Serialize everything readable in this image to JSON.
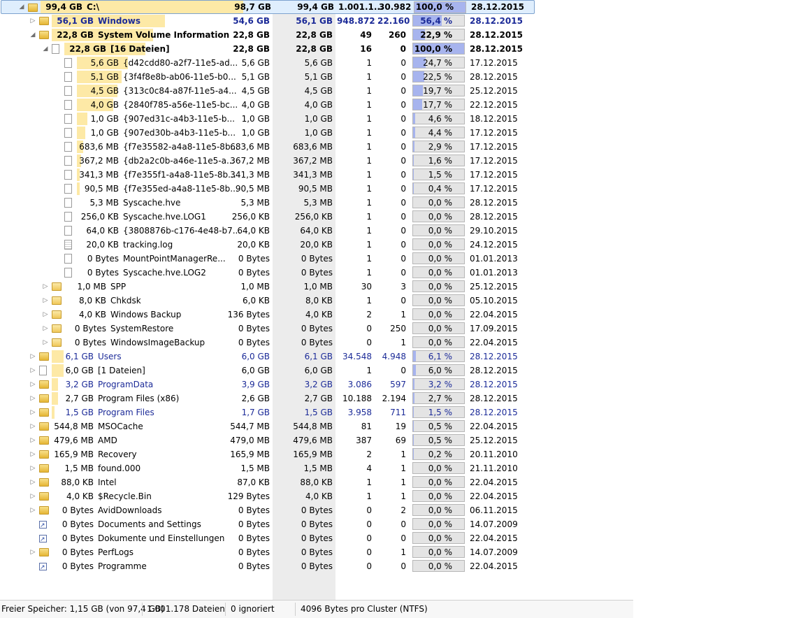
{
  "colors": {
    "size_bar": "#fde9a6",
    "percent_fill": "#a7b4ee",
    "link_text": "#1c2b98",
    "selection": "#dfeefd"
  },
  "rows": [
    {
      "depth": 0,
      "expander": "open",
      "icon": "folder",
      "style": "sel bold",
      "size": "99,4 GB",
      "name": "C:\\",
      "c1": "98,7 GB",
      "c2": "99,4 GB",
      "c3": "1.001.1...",
      "c4": "30.982",
      "pct": "100,0 %",
      "pct_value": 100,
      "date": "28.12.2015",
      "bar": 1.0
    },
    {
      "depth": 1,
      "expander": "closed",
      "icon": "folder",
      "style": "blue bold",
      "size": "56,1 GB",
      "name": "Windows",
      "c1": "54,6 GB",
      "c2": "56,1 GB",
      "c3": "948.872",
      "c4": "22.160",
      "pct": "56,4 %",
      "pct_value": 56.4,
      "date": "28.12.2015",
      "bar": 0.56
    },
    {
      "depth": 1,
      "expander": "open",
      "icon": "folder",
      "style": "bold",
      "size": "22,8 GB",
      "name": "System Volume Information",
      "c1": "22,8 GB",
      "c2": "22,8 GB",
      "c3": "49",
      "c4": "260",
      "pct": "22,9 %",
      "pct_value": 22.9,
      "date": "28.12.2015",
      "bar": 0.5
    },
    {
      "depth": 2,
      "expander": "open",
      "icon": "file",
      "style": "bold",
      "size": "22,8 GB",
      "name": "[16 Dateien]",
      "c1": "22,8 GB",
      "c2": "22,8 GB",
      "c3": "16",
      "c4": "0",
      "pct": "100,0 %",
      "pct_value": 100,
      "date": "28.12.2015",
      "bar": 0.4
    },
    {
      "depth": 3,
      "expander": "",
      "icon": "file",
      "style": "",
      "size": "5,6 GB",
      "name": "{d42cdd80-a2f7-11e5-ad...",
      "c1": "5,6 GB",
      "c2": "5,6 GB",
      "c3": "1",
      "c4": "0",
      "pct": "24,7 %",
      "pct_value": 24.7,
      "date": "17.12.2015",
      "bar": 0.25
    },
    {
      "depth": 3,
      "expander": "",
      "icon": "file",
      "style": "",
      "size": "5,1 GB",
      "name": "{3f4f8e8b-ab06-11e5-b0...",
      "c1": "5,1 GB",
      "c2": "5,1 GB",
      "c3": "1",
      "c4": "0",
      "pct": "22,5 %",
      "pct_value": 22.5,
      "date": "28.12.2015",
      "bar": 0.22
    },
    {
      "depth": 3,
      "expander": "",
      "icon": "file",
      "style": "",
      "size": "4,5 GB",
      "name": "{313c0c84-a87f-11e5-a4...",
      "c1": "4,5 GB",
      "c2": "4,5 GB",
      "c3": "1",
      "c4": "0",
      "pct": "19,7 %",
      "pct_value": 19.7,
      "date": "25.12.2015",
      "bar": 0.2
    },
    {
      "depth": 3,
      "expander": "",
      "icon": "file",
      "style": "",
      "size": "4,0 GB",
      "name": "{2840f785-a56e-11e5-bc...",
      "c1": "4,0 GB",
      "c2": "4,0 GB",
      "c3": "1",
      "c4": "0",
      "pct": "17,7 %",
      "pct_value": 17.7,
      "date": "22.12.2015",
      "bar": 0.18
    },
    {
      "depth": 3,
      "expander": "",
      "icon": "file",
      "style": "",
      "size": "1,0 GB",
      "name": "{907ed31c-a4b3-11e5-b...",
      "c1": "1,0 GB",
      "c2": "1,0 GB",
      "c3": "1",
      "c4": "0",
      "pct": "4,6 %",
      "pct_value": 4.6,
      "date": "18.12.2015",
      "bar": 0.05
    },
    {
      "depth": 3,
      "expander": "",
      "icon": "file",
      "style": "",
      "size": "1,0 GB",
      "name": "{907ed30b-a4b3-11e5-b...",
      "c1": "1,0 GB",
      "c2": "1,0 GB",
      "c3": "1",
      "c4": "0",
      "pct": "4,4 %",
      "pct_value": 4.4,
      "date": "17.12.2015",
      "bar": 0.04
    },
    {
      "depth": 3,
      "expander": "",
      "icon": "file",
      "style": "",
      "size": "683,6 MB",
      "name": "{f7e35582-a4a8-11e5-8b...",
      "c1": "683,6 MB",
      "c2": "683,6 MB",
      "c3": "1",
      "c4": "0",
      "pct": "2,9 %",
      "pct_value": 2.9,
      "date": "17.12.2015",
      "bar": 0.03
    },
    {
      "depth": 3,
      "expander": "",
      "icon": "file",
      "style": "",
      "size": "367,2 MB",
      "name": "{db2a2c0b-a46e-11e5-a...",
      "c1": "367,2 MB",
      "c2": "367,2 MB",
      "c3": "1",
      "c4": "0",
      "pct": "1,6 %",
      "pct_value": 1.6,
      "date": "17.12.2015",
      "bar": 0.02
    },
    {
      "depth": 3,
      "expander": "",
      "icon": "file",
      "style": "",
      "size": "341,3 MB",
      "name": "{f7e355f1-a4a8-11e5-8b...",
      "c1": "341,3 MB",
      "c2": "341,3 MB",
      "c3": "1",
      "c4": "0",
      "pct": "1,5 %",
      "pct_value": 1.5,
      "date": "17.12.2015",
      "bar": 0.015
    },
    {
      "depth": 3,
      "expander": "",
      "icon": "file",
      "style": "",
      "size": "90,5 MB",
      "name": "{f7e355ed-a4a8-11e5-8b...",
      "c1": "90,5 MB",
      "c2": "90,5 MB",
      "c3": "1",
      "c4": "0",
      "pct": "0,4 %",
      "pct_value": 0.4,
      "date": "17.12.2015",
      "bar": 0.005
    },
    {
      "depth": 3,
      "expander": "",
      "icon": "file",
      "style": "",
      "size": "5,3 MB",
      "name": "Syscache.hve",
      "c1": "5,3 MB",
      "c2": "5,3 MB",
      "c3": "1",
      "c4": "0",
      "pct": "0,0 %",
      "pct_value": 0,
      "date": "28.12.2015",
      "bar": 0
    },
    {
      "depth": 3,
      "expander": "",
      "icon": "file",
      "style": "",
      "size": "256,0 KB",
      "name": "Syscache.hve.LOG1",
      "c1": "256,0 KB",
      "c2": "256,0 KB",
      "c3": "1",
      "c4": "0",
      "pct": "0,0 %",
      "pct_value": 0,
      "date": "28.12.2015",
      "bar": 0
    },
    {
      "depth": 3,
      "expander": "",
      "icon": "file",
      "style": "",
      "size": "64,0 KB",
      "name": "{3808876b-c176-4e48-b7...",
      "c1": "64,0 KB",
      "c2": "64,0 KB",
      "c3": "1",
      "c4": "0",
      "pct": "0,0 %",
      "pct_value": 0,
      "date": "29.10.2015",
      "bar": 0
    },
    {
      "depth": 3,
      "expander": "",
      "icon": "log",
      "style": "",
      "size": "20,0 KB",
      "name": "tracking.log",
      "c1": "20,0 KB",
      "c2": "20,0 KB",
      "c3": "1",
      "c4": "0",
      "pct": "0,0 %",
      "pct_value": 0,
      "date": "24.12.2015",
      "bar": 0
    },
    {
      "depth": 3,
      "expander": "",
      "icon": "file",
      "style": "",
      "size": "0 Bytes",
      "name": "MountPointManagerRe...",
      "c1": "0 Bytes",
      "c2": "0 Bytes",
      "c3": "1",
      "c4": "0",
      "pct": "0,0 %",
      "pct_value": 0,
      "date": "01.01.2013",
      "bar": 0
    },
    {
      "depth": 3,
      "expander": "",
      "icon": "file",
      "style": "",
      "size": "0 Bytes",
      "name": "Syscache.hve.LOG2",
      "c1": "0 Bytes",
      "c2": "0 Bytes",
      "c3": "1",
      "c4": "0",
      "pct": "0,0 %",
      "pct_value": 0,
      "date": "01.01.2013",
      "bar": 0
    },
    {
      "depth": 2,
      "expander": "closed",
      "icon": "folder",
      "style": "",
      "size": "1,0 MB",
      "name": "SPP",
      "c1": "1,0 MB",
      "c2": "1,0 MB",
      "c3": "30",
      "c4": "3",
      "pct": "0,0 %",
      "pct_value": 0,
      "date": "25.12.2015",
      "bar": 0
    },
    {
      "depth": 2,
      "expander": "closed",
      "icon": "folder",
      "style": "",
      "size": "8,0 KB",
      "name": "Chkdsk",
      "c1": "6,0 KB",
      "c2": "8,0 KB",
      "c3": "1",
      "c4": "0",
      "pct": "0,0 %",
      "pct_value": 0,
      "date": "05.10.2015",
      "bar": 0
    },
    {
      "depth": 2,
      "expander": "closed",
      "icon": "folder",
      "style": "",
      "size": "4,0 KB",
      "name": "Windows Backup",
      "c1": "136 Bytes",
      "c2": "4,0 KB",
      "c3": "2",
      "c4": "1",
      "pct": "0,0 %",
      "pct_value": 0,
      "date": "22.04.2015",
      "bar": 0
    },
    {
      "depth": 2,
      "expander": "closed",
      "icon": "folder",
      "style": "",
      "size": "0 Bytes",
      "name": "SystemRestore",
      "c1": "0 Bytes",
      "c2": "0 Bytes",
      "c3": "0",
      "c4": "250",
      "pct": "0,0 %",
      "pct_value": 0,
      "date": "17.09.2015",
      "bar": 0
    },
    {
      "depth": 2,
      "expander": "closed",
      "icon": "folder",
      "style": "",
      "size": "0 Bytes",
      "name": "WindowsImageBackup",
      "c1": "0 Bytes",
      "c2": "0 Bytes",
      "c3": "0",
      "c4": "1",
      "pct": "0,0 %",
      "pct_value": 0,
      "date": "22.04.2015",
      "bar": 0
    },
    {
      "depth": 1,
      "expander": "closed",
      "icon": "folder",
      "style": "blue",
      "size": "6,1 GB",
      "name": "Users",
      "c1": "6,0 GB",
      "c2": "6,1 GB",
      "c3": "34.548",
      "c4": "4.948",
      "pct": "6,1 %",
      "pct_value": 6.1,
      "date": "28.12.2015",
      "bar": 0.06
    },
    {
      "depth": 1,
      "expander": "closed",
      "icon": "file",
      "style": "",
      "size": "6,0 GB",
      "name": "[1 Dateien]",
      "c1": "6,0 GB",
      "c2": "6,0 GB",
      "c3": "1",
      "c4": "0",
      "pct": "6,0 %",
      "pct_value": 6.0,
      "date": "28.12.2015",
      "bar": 0.06
    },
    {
      "depth": 1,
      "expander": "closed",
      "icon": "folder",
      "style": "blue",
      "size": "3,2 GB",
      "name": "ProgramData",
      "c1": "3,9 GB",
      "c2": "3,2 GB",
      "c3": "3.086",
      "c4": "597",
      "pct": "3,2 %",
      "pct_value": 3.2,
      "date": "28.12.2015",
      "bar": 0.03
    },
    {
      "depth": 1,
      "expander": "closed",
      "icon": "folder",
      "style": "",
      "size": "2,7 GB",
      "name": "Program Files (x86)",
      "c1": "2,6 GB",
      "c2": "2,7 GB",
      "c3": "10.188",
      "c4": "2.194",
      "pct": "2,7 %",
      "pct_value": 2.7,
      "date": "28.12.2015",
      "bar": 0.03
    },
    {
      "depth": 1,
      "expander": "closed",
      "icon": "folder",
      "style": "blue",
      "size": "1,5 GB",
      "name": "Program Files",
      "c1": "1,7 GB",
      "c2": "1,5 GB",
      "c3": "3.958",
      "c4": "711",
      "pct": "1,5 %",
      "pct_value": 1.5,
      "date": "28.12.2015",
      "bar": 0.015
    },
    {
      "depth": 1,
      "expander": "closed",
      "icon": "folder",
      "style": "",
      "size": "544,8 MB",
      "name": "MSOCache",
      "c1": "544,7 MB",
      "c2": "544,8 MB",
      "c3": "81",
      "c4": "19",
      "pct": "0,5 %",
      "pct_value": 0.5,
      "date": "22.04.2015",
      "bar": 0
    },
    {
      "depth": 1,
      "expander": "closed",
      "icon": "folder",
      "style": "",
      "size": "479,6 MB",
      "name": "AMD",
      "c1": "479,0 MB",
      "c2": "479,6 MB",
      "c3": "387",
      "c4": "69",
      "pct": "0,5 %",
      "pct_value": 0.5,
      "date": "25.12.2015",
      "bar": 0
    },
    {
      "depth": 1,
      "expander": "closed",
      "icon": "folder",
      "style": "",
      "size": "165,9 MB",
      "name": "Recovery",
      "c1": "165,9 MB",
      "c2": "165,9 MB",
      "c3": "2",
      "c4": "1",
      "pct": "0,2 %",
      "pct_value": 0.2,
      "date": "20.11.2010",
      "bar": 0
    },
    {
      "depth": 1,
      "expander": "closed",
      "icon": "folder",
      "style": "",
      "size": "1,5 MB",
      "name": "found.000",
      "c1": "1,5 MB",
      "c2": "1,5 MB",
      "c3": "4",
      "c4": "1",
      "pct": "0,0 %",
      "pct_value": 0,
      "date": "21.11.2010",
      "bar": 0
    },
    {
      "depth": 1,
      "expander": "closed",
      "icon": "folder",
      "style": "",
      "size": "88,0 KB",
      "name": "Intel",
      "c1": "87,0 KB",
      "c2": "88,0 KB",
      "c3": "1",
      "c4": "1",
      "pct": "0,0 %",
      "pct_value": 0,
      "date": "22.04.2015",
      "bar": 0
    },
    {
      "depth": 1,
      "expander": "closed",
      "icon": "folder",
      "style": "",
      "size": "4,0 KB",
      "name": "$Recycle.Bin",
      "c1": "129 Bytes",
      "c2": "4,0 KB",
      "c3": "1",
      "c4": "1",
      "pct": "0,0 %",
      "pct_value": 0,
      "date": "22.04.2015",
      "bar": 0
    },
    {
      "depth": 1,
      "expander": "closed",
      "icon": "folder",
      "style": "",
      "size": "0 Bytes",
      "name": "AvidDownloads",
      "c1": "0 Bytes",
      "c2": "0 Bytes",
      "c3": "0",
      "c4": "2",
      "pct": "0,0 %",
      "pct_value": 0,
      "date": "06.11.2015",
      "bar": 0
    },
    {
      "depth": 1,
      "expander": "",
      "icon": "link",
      "style": "",
      "size": "0 Bytes",
      "name": "Documents and Settings",
      "c1": "0 Bytes",
      "c2": "0 Bytes",
      "c3": "0",
      "c4": "0",
      "pct": "0,0 %",
      "pct_value": 0,
      "date": "14.07.2009",
      "bar": 0
    },
    {
      "depth": 1,
      "expander": "",
      "icon": "link",
      "style": "",
      "size": "0 Bytes",
      "name": "Dokumente und Einstellungen",
      "c1": "0 Bytes",
      "c2": "0 Bytes",
      "c3": "0",
      "c4": "0",
      "pct": "0,0 %",
      "pct_value": 0,
      "date": "22.04.2015",
      "bar": 0
    },
    {
      "depth": 1,
      "expander": "closed",
      "icon": "folder",
      "style": "",
      "size": "0 Bytes",
      "name": "PerfLogs",
      "c1": "0 Bytes",
      "c2": "0 Bytes",
      "c3": "0",
      "c4": "1",
      "pct": "0,0 %",
      "pct_value": 0,
      "date": "14.07.2009",
      "bar": 0
    },
    {
      "depth": 1,
      "expander": "",
      "icon": "link",
      "style": "",
      "size": "0 Bytes",
      "name": "Programme",
      "c1": "0 Bytes",
      "c2": "0 Bytes",
      "c3": "0",
      "c4": "0",
      "pct": "0,0 %",
      "pct_value": 0,
      "date": "22.04.2015",
      "bar": 0
    }
  ],
  "status": {
    "free_space": "Freier Speicher: 1,15 GB  (von 97,4 GB)",
    "files": "1.001.178  Dateien",
    "ignored": "0 ignoriert",
    "cluster": "4096  Bytes pro Cluster (NTFS)"
  }
}
